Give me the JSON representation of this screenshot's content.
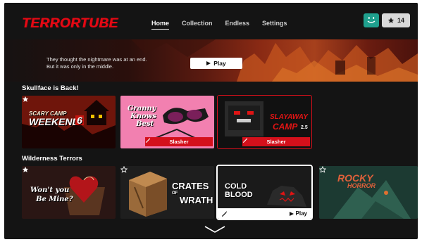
{
  "app": {
    "logo": "TERRORTUBE"
  },
  "nav": [
    {
      "label": "Home",
      "active": true
    },
    {
      "label": "Collection",
      "active": false
    },
    {
      "label": "Endless",
      "active": false
    },
    {
      "label": "Settings",
      "active": false
    }
  ],
  "profile": {
    "avatar_icon": "smiley-face-icon",
    "avatar_color": "#1fa08e"
  },
  "favorites": {
    "count": "14",
    "icon": "star-icon"
  },
  "hero": {
    "line1": "They thought the nightmare was at an end.",
    "line2": "But it was only in the middle.",
    "play_label": "Play"
  },
  "rows": [
    {
      "title": "Skullface is Back!",
      "cards": [
        {
          "title_line1": "SCARY CAMP",
          "title_line2": "WEEKEND",
          "badge": "6",
          "favorited": true
        },
        {
          "title_line1": "Granny",
          "title_line2": "Knows",
          "title_line3": "Best",
          "tag": "Slasher"
        },
        {
          "title_line1": "SLAYAWAY",
          "title_line2": "CAMP",
          "badge": "2.5",
          "tag": "Slasher"
        }
      ]
    },
    {
      "title": "Wilderness Terrors",
      "cards": [
        {
          "title_line1": "Won't you",
          "title_line2": "Be Mine?",
          "favorited": true
        },
        {
          "title_line1": "CRATES",
          "title_line2": "OF",
          "title_line3": "WRATH",
          "favorited": false
        },
        {
          "title_line1": "COLD",
          "title_line2": "BLOOD",
          "play_label": "Play",
          "selected": true
        },
        {
          "title_line1": "ROCKY",
          "title_line2": "HORROR",
          "favorited": false
        }
      ]
    }
  ],
  "accent": "#e50914"
}
